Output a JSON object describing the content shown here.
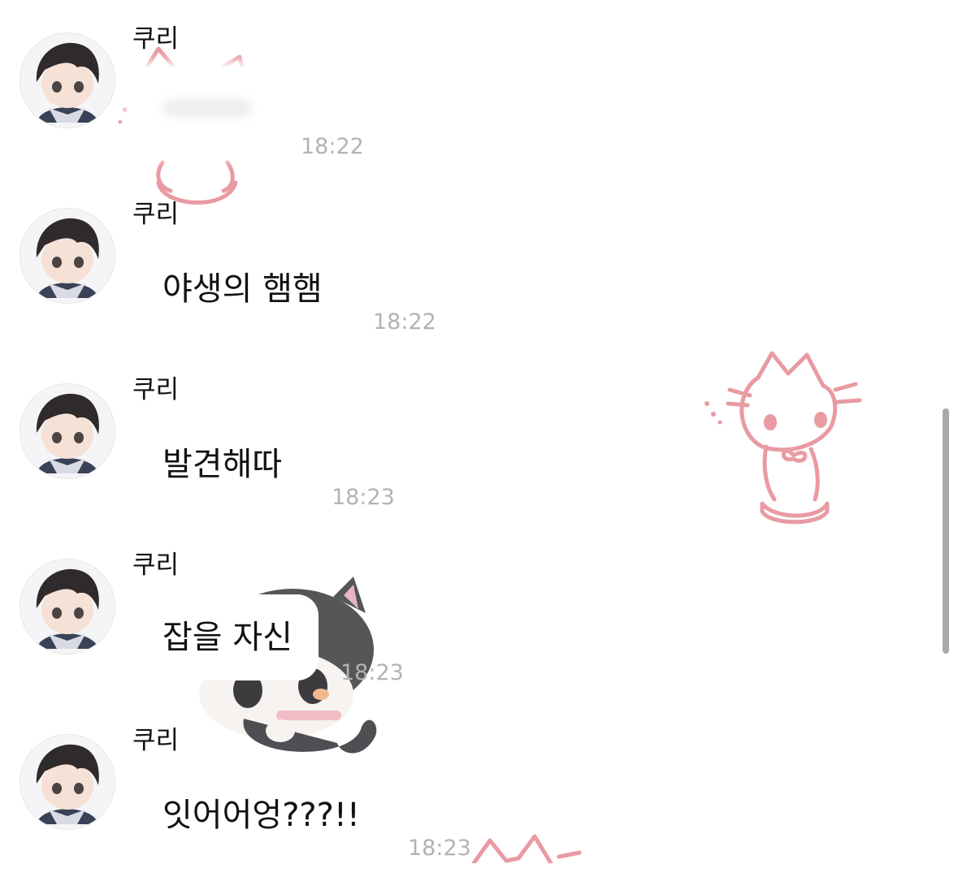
{
  "colors": {
    "background": "#ffffff",
    "bubble": "#ffffff",
    "sender_text": "#111111",
    "time_text": "#b3b3b3",
    "sticker_pink": "#e99aa2",
    "scrollbar": "#a9a9ab"
  },
  "messages": [
    {
      "sender": "쿠리",
      "text": "",
      "time": "18:22"
    },
    {
      "sender": "쿠리",
      "text": "야생의 햄햄",
      "time": "18:22"
    },
    {
      "sender": "쿠리",
      "text": "발견해따",
      "time": "18:23"
    },
    {
      "sender": "쿠리",
      "text": "잡을 자신",
      "time": "18:23"
    },
    {
      "sender": "쿠리",
      "text": "잇어어엉???!!",
      "time": "18:23"
    }
  ],
  "icons": {
    "avatar": "profile-avatar-icon",
    "background_sticker": "cat-doodle-icon",
    "kitten_sticker": "kitten-sticker-icon"
  }
}
